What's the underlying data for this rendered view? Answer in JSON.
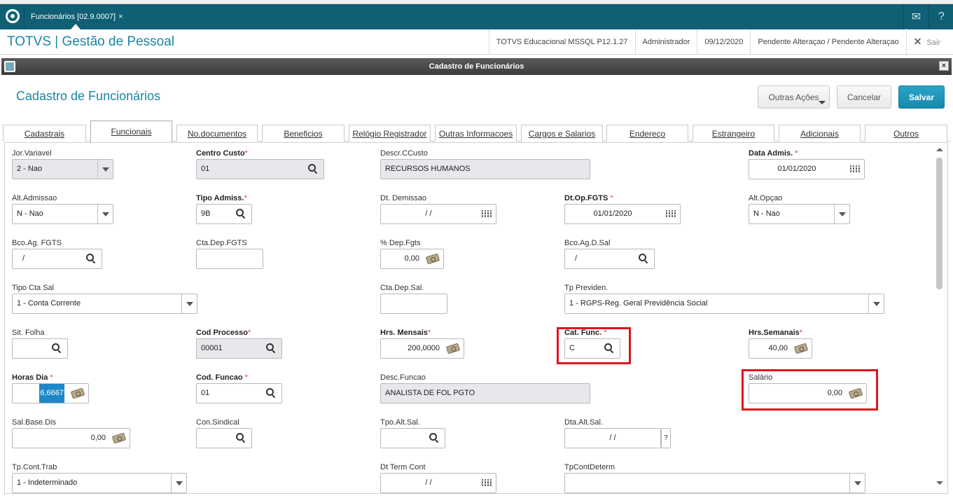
{
  "appbar": {
    "tab_label": "Funcionários [02.9.0007]",
    "tab_close": "×"
  },
  "header": {
    "app_title": "TOTVS | Gestão de Pessoal",
    "environment": "TOTVS Educacional MSSQL P12.1.27",
    "user": "Administrador",
    "date": "09/12/2020",
    "status": "Pendente Alteraçao / Pendente Alteraçao",
    "exit_label": "Sair"
  },
  "dialog": {
    "title": "Cadastro de Funcionários",
    "close": "×"
  },
  "form": {
    "title": "Cadastro de Funcionários",
    "more_actions": "Outras Ações",
    "cancel": "Cancelar",
    "save": "Salvar"
  },
  "tabs": [
    "Cadastrais",
    "Funcionais",
    "No.documentos",
    "Beneficios",
    "Relógio Registrador",
    "Outras Informacoes",
    "Cargos e Salarios",
    "Endereço",
    "Estrangeiro",
    "Adicionais",
    "Outros"
  ],
  "active_tab": "Funcionais",
  "fields": {
    "jor_variavel": {
      "label": "Jor.Variavel",
      "value": "2 - Nao"
    },
    "centro_custo": {
      "label": "Centro Custo",
      "value": "01"
    },
    "descr_ccusto": {
      "label": "Descr.CCusto",
      "value": "RECURSOS HUMANOS"
    },
    "data_admis": {
      "label": "Data Admis. ",
      "value": "01/01/2020"
    },
    "alt_admissao": {
      "label": "Alt.Admissao",
      "value": "N - Nao"
    },
    "tipo_admiss": {
      "label": "Tipo Admiss.",
      "value": "9B"
    },
    "dt_demissao": {
      "label": "Dt. Demissao",
      "value": "/ /"
    },
    "dt_op_fgts": {
      "label": "Dt.Op.FGTS ",
      "value": "01/01/2020"
    },
    "alt_opcao": {
      "label": "Alt.Opçao",
      "value": "N - Nao"
    },
    "bco_ag_fgts": {
      "label": "Bco.Ag. FGTS",
      "value": "/"
    },
    "cta_dep_fgts": {
      "label": "Cta.Dep.FGTS",
      "value": ""
    },
    "pct_dep_fgts": {
      "label": "% Dep.Fgts",
      "value": "0,00"
    },
    "bco_ag_d_sal": {
      "label": "Bco.Ag.D.Sal",
      "value": "/"
    },
    "tipo_cta_sal": {
      "label": "Tipo Cta Sal",
      "value": "1 - Conta Corrente"
    },
    "cta_dep_sal": {
      "label": "Cta.Dep.Sal.",
      "value": ""
    },
    "tp_previden": {
      "label": "Tp Previden.",
      "value": "1 - RGPS-Reg. Geral Previdência Social"
    },
    "sit_folha": {
      "label": "Sit. Folha",
      "value": ""
    },
    "cod_processo": {
      "label": "Cod Processo",
      "value": "00001"
    },
    "hrs_mensais": {
      "label": "Hrs. Mensais",
      "value": "200,0000"
    },
    "cat_func": {
      "label": "Cat. Func. ",
      "value": "C"
    },
    "hrs_semanais": {
      "label": "Hrs.Semanais",
      "value": "40,00"
    },
    "horas_dia": {
      "label": "Horas Dia ",
      "value": "6,6667"
    },
    "cod_funcao": {
      "label": "Cod. Funcao ",
      "value": "01"
    },
    "desc_funcao": {
      "label": "Desc.Funcao",
      "value": "ANALISTA DE FOL PGTO"
    },
    "salario": {
      "label": "Salário",
      "value": "0,00"
    },
    "sal_base_dis": {
      "label": "Sal.Base.Dis",
      "value": "0,00"
    },
    "con_sindical": {
      "label": "Con.Sindical",
      "value": ""
    },
    "tpo_alt_sal": {
      "label": "Tpo.Alt.Sal.",
      "value": ""
    },
    "dta_alt_sal": {
      "label": "Dta.Alt.Sal.",
      "value": "/ /",
      "help": "?"
    },
    "tp_cont_trab": {
      "label": "Tp.Cont.Trab",
      "value": "1 - Indeterminado"
    },
    "dt_term_cont": {
      "label": "Dt Term Cont",
      "value": "/ /"
    },
    "tp_cont_determ": {
      "label": "TpContDeterm",
      "value": ""
    }
  },
  "required_mark": "*",
  "highlight_color": "#e0141e"
}
